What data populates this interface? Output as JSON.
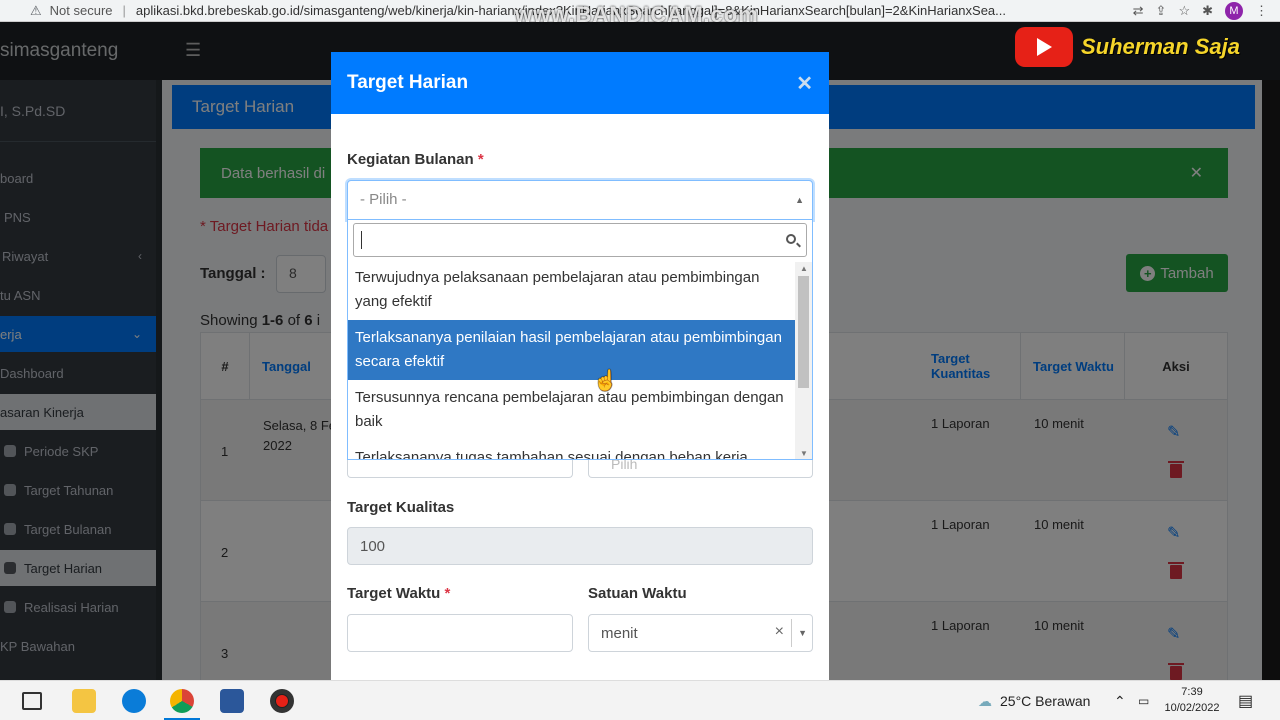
{
  "browser": {
    "security_label": "Not secure",
    "url": "aplikasi.bkd.brebeskab.go.id/simasganteng/web/kinerja/kin-harianx/index?KinHarianxSearch[tanggal]=8&KinHarianxSearch[bulan]=2&KinHarianxSea...",
    "profile_initial": "M",
    "watermark": "www.BANDICAM.com"
  },
  "overlay_badge": {
    "channel": "Suherman Saja"
  },
  "app": {
    "brand": "simasganteng",
    "user_name": "I, S.Pd.SD"
  },
  "sidebar": {
    "items": [
      {
        "label": "board"
      },
      {
        "label": "PNS"
      },
      {
        "label": "Riwayat"
      },
      {
        "label": "tu ASN"
      },
      {
        "label": "erja"
      },
      {
        "label": "Dashboard"
      },
      {
        "label": "asaran Kinerja"
      },
      {
        "label": "Periode SKP"
      },
      {
        "label": "Target Tahunan"
      },
      {
        "label": "Target Bulanan"
      },
      {
        "label": "Target Harian"
      },
      {
        "label": "Realisasi Harian"
      },
      {
        "label": "KP Bawahan"
      }
    ]
  },
  "page": {
    "header": "Target Harian",
    "alert": "Data berhasil di",
    "warning": "* Target Harian tida",
    "tanggal_label": "Tanggal :",
    "tanggal_value": "8",
    "tambah_label": "Tambah",
    "showing_prefix": "Showing ",
    "showing_range": "1-6",
    "showing_of": " of ",
    "showing_total": "6",
    "showing_suffix": " i"
  },
  "table": {
    "headers": {
      "no": "#",
      "tanggal": "Tanggal",
      "target_kuantitas": "Target Kuantitas",
      "target_waktu": "Target Waktu",
      "aksi": "Aksi"
    },
    "rows": [
      {
        "no": "1",
        "tanggal": "Selasa, 8 Fe\n2022",
        "kuantitas": "1 Laporan",
        "waktu": "10 menit"
      },
      {
        "no": "2",
        "tanggal": "",
        "kuantitas": "1 Laporan",
        "waktu": "10 menit"
      },
      {
        "no": "3",
        "tanggal": "",
        "kuantitas": "1 Laporan",
        "waktu": "10 menit"
      }
    ]
  },
  "modal": {
    "title": "Target Harian",
    "kegiatan_label": "Kegiatan Bulanan",
    "required_mark": "*",
    "select_placeholder": "- Pilih -",
    "options": [
      "Terwujudnya pelaksanaan pembelajaran atau pembimbingan yang efektif",
      "Terlaksananya penilaian hasil pembelajaran atau pembimbingan secara efektif",
      "Tersusunnya rencana pembelajaran atau pembimbingan dengan baik",
      "Terlaksananya tugas tambahan sesuai dengan beban kerja"
    ],
    "hidden_select_placeholder": "Pilih",
    "kualitas_label": "Target Kualitas",
    "kualitas_value": "100",
    "waktu_label": "Target Waktu",
    "satuan_label": "Satuan Waktu",
    "satuan_value": "menit"
  },
  "taskbar": {
    "weather": "25°C  Berawan",
    "time": "7:39",
    "date": "10/02/2022"
  },
  "colors": {
    "primary": "#007bff",
    "success": "#28a745",
    "danger": "#dc3545",
    "highlight": "#2f78c4"
  }
}
